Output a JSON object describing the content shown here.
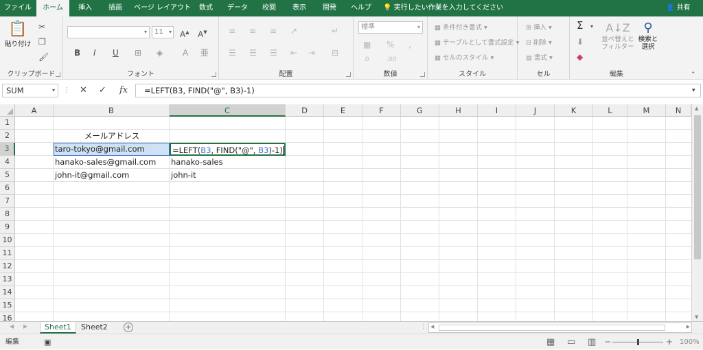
{
  "ribbon_tabs": [
    "ファイル",
    "ホーム",
    "挿入",
    "描画",
    "ページ レイアウト",
    "数式",
    "データ",
    "校閲",
    "表示",
    "開発",
    "ヘルプ"
  ],
  "active_tab": "ホーム",
  "tell_me": "実行したい作業を入力してください",
  "share": "共有",
  "groups": {
    "clipboard": {
      "label": "クリップボード",
      "paste": "貼り付け"
    },
    "font": {
      "label": "フォント",
      "size": "11",
      "buttons": [
        "B",
        "I",
        "U"
      ]
    },
    "alignment": {
      "label": "配置"
    },
    "number": {
      "label": "数値",
      "format": "標準"
    },
    "style": {
      "label": "スタイル",
      "items": [
        "条件付き書式",
        "テーブルとして書式設定",
        "セルのスタイル"
      ]
    },
    "cells": {
      "label": "セル",
      "items": [
        "挿入",
        "削除",
        "書式"
      ]
    },
    "edit": {
      "label": "編集",
      "sort": "並べ替えと\nフィルター",
      "find": "検索と\n選択"
    }
  },
  "formula_bar": {
    "name_box": "SUM",
    "formula": "=LEFT(B3, FIND(\"@\", B3)-1)"
  },
  "columns": [
    "A",
    "B",
    "C",
    "D",
    "E",
    "F",
    "G",
    "H",
    "I",
    "J",
    "K",
    "L",
    "M",
    "N"
  ],
  "selected_column": "C",
  "rows": [
    "1",
    "2",
    "3",
    "4",
    "5",
    "6",
    "7",
    "8",
    "9",
    "10",
    "11",
    "12",
    "13",
    "14",
    "15",
    "16"
  ],
  "selected_row": "3",
  "cells": {
    "B2": "メールアドレス",
    "B3": "taro-tokyo@gmail.com",
    "B4": "hanako-sales@gmail.com",
    "B5": "john-it@gmail.com",
    "C3_parts": [
      "=LEFT(",
      "B3",
      ", FIND(\"@\", ",
      "B3",
      ")-1)"
    ],
    "C4": "hanako-sales",
    "C5": "john-it"
  },
  "sheets": [
    "Sheet1",
    "Sheet2"
  ],
  "active_sheet": "Sheet1",
  "status": {
    "mode": "編集",
    "zoom": "100%"
  }
}
